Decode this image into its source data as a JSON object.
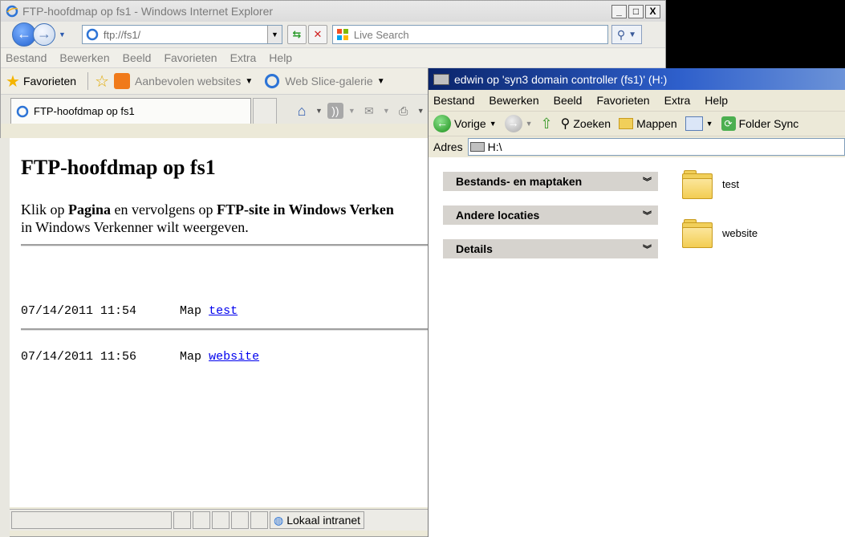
{
  "ie": {
    "title": "FTP-hoofdmap op fs1 - Windows Internet Explorer",
    "window_buttons": [
      "_",
      "□",
      "X"
    ],
    "address": "ftp://fs1/",
    "search_placeholder": "Live Search",
    "menu": [
      "Bestand",
      "Bewerken",
      "Beeld",
      "Favorieten",
      "Extra",
      "Help"
    ],
    "favorites": {
      "favorites_label": "Favorieten",
      "recommended": "Aanbevolen websites",
      "webslice": "Web Slice-galerie"
    },
    "tab_title": "FTP-hoofdmap op fs1",
    "page": {
      "heading": "FTP-hoofdmap op fs1",
      "intro_1": "Klik op ",
      "intro_b1": "Pagina",
      "intro_2": " en vervolgens op ",
      "intro_b2": "FTP-site in Windows Verken",
      "intro_3": "in Windows Verkenner wilt weergeven.",
      "entries": [
        {
          "date": "07/14/2011 11:54",
          "type": "Map",
          "name": "test"
        },
        {
          "date": "07/14/2011 11:56",
          "type": "Map",
          "name": "website"
        }
      ]
    },
    "status_zone": "Lokaal intranet"
  },
  "explorer": {
    "title": "edwin op 'syn3 domain controller (fs1)' (H:)",
    "menu": [
      "Bestand",
      "Bewerken",
      "Beeld",
      "Favorieten",
      "Extra",
      "Help"
    ],
    "toolbar": {
      "back": "Vorige",
      "search": "Zoeken",
      "folders": "Mappen",
      "sync": "Folder Sync"
    },
    "address_label": "Adres",
    "address": "H:\\",
    "tasks": [
      "Bestands- en maptaken",
      "Andere locaties",
      "Details"
    ],
    "folders": [
      "test",
      "website"
    ]
  },
  "colors": {
    "explorer_title": "#0a246a",
    "task_header": "#d6d3ce",
    "link": "#0000ee",
    "folder": "#f1cf5a"
  }
}
